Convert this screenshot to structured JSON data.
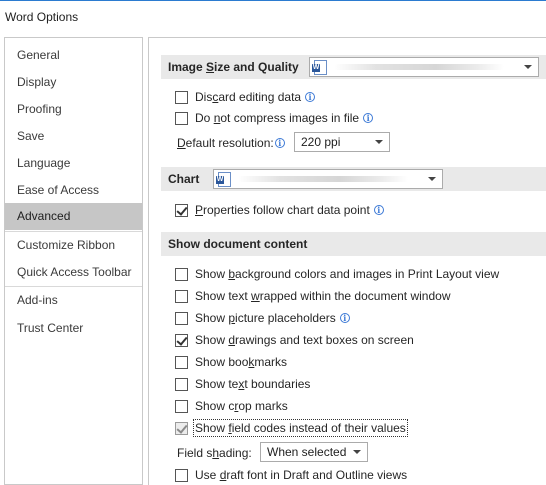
{
  "window": {
    "title": "Word Options"
  },
  "nav": {
    "items": [
      {
        "label": "General"
      },
      {
        "label": "Display"
      },
      {
        "label": "Proofing"
      },
      {
        "label": "Save"
      },
      {
        "label": "Language"
      },
      {
        "label": "Ease of Access"
      },
      {
        "label": "Advanced",
        "selected": true
      },
      {
        "label": "Customize Ribbon"
      },
      {
        "label": "Quick Access Toolbar"
      },
      {
        "label": "Add-ins"
      },
      {
        "label": "Trust Center"
      }
    ]
  },
  "image_section": {
    "title_pre": "Image ",
    "title_u": "S",
    "title_post": "ize and Quality",
    "document_select_value": "",
    "discard": {
      "pre": "Dis",
      "u": "c",
      "post": "ard editing data",
      "checked": false
    },
    "no_compress": {
      "pre": "Do ",
      "u": "n",
      "post": "ot compress images in file",
      "checked": false
    },
    "resolution": {
      "pre": "",
      "u": "D",
      "post": "efault resolution:",
      "value": "220 ppi"
    }
  },
  "chart_section": {
    "title": "Chart",
    "document_select_value": "",
    "properties_follow": {
      "pre": "",
      "u": "P",
      "post": "roperties follow chart data point",
      "checked": true
    }
  },
  "show_section": {
    "title": "Show document content",
    "options": [
      {
        "pre": "Show ",
        "u": "b",
        "post": "ackground colors and images in Print Layout view",
        "checked": false
      },
      {
        "pre": "Show text ",
        "u": "w",
        "post": "rapped within the document window",
        "checked": false
      },
      {
        "pre": "Show ",
        "u": "p",
        "post": "icture placeholders",
        "checked": false
      },
      {
        "pre": "Show ",
        "u": "d",
        "post": "rawings and text boxes on screen",
        "checked": true
      },
      {
        "pre": "Show boo",
        "u": "k",
        "post": "marks",
        "checked": false
      },
      {
        "pre": "Show te",
        "u": "x",
        "post": "t boundaries",
        "checked": false
      },
      {
        "pre": "Show c",
        "u": "r",
        "post": "op marks",
        "checked": false
      },
      {
        "pre": "Show ",
        "u": "f",
        "post": "ield codes instead of their values",
        "checked": true,
        "disabled": true
      }
    ],
    "field_shading": {
      "pre": "Field s",
      "u": "h",
      "post": "ading:",
      "value": "When selected"
    },
    "draft_font": {
      "pre": "Use ",
      "u": "d",
      "post": "raft font in Draft and Outline views",
      "checked": false
    }
  },
  "colors": {
    "accent": "#2b7bd0",
    "selected_nav": "#c6c6c6",
    "section_header": "#e9e9e9",
    "info": "#3d7ad6"
  },
  "icons": {
    "info": "info-circle-icon",
    "document": "word-document-icon",
    "dropdown": "chevron-down-icon"
  }
}
